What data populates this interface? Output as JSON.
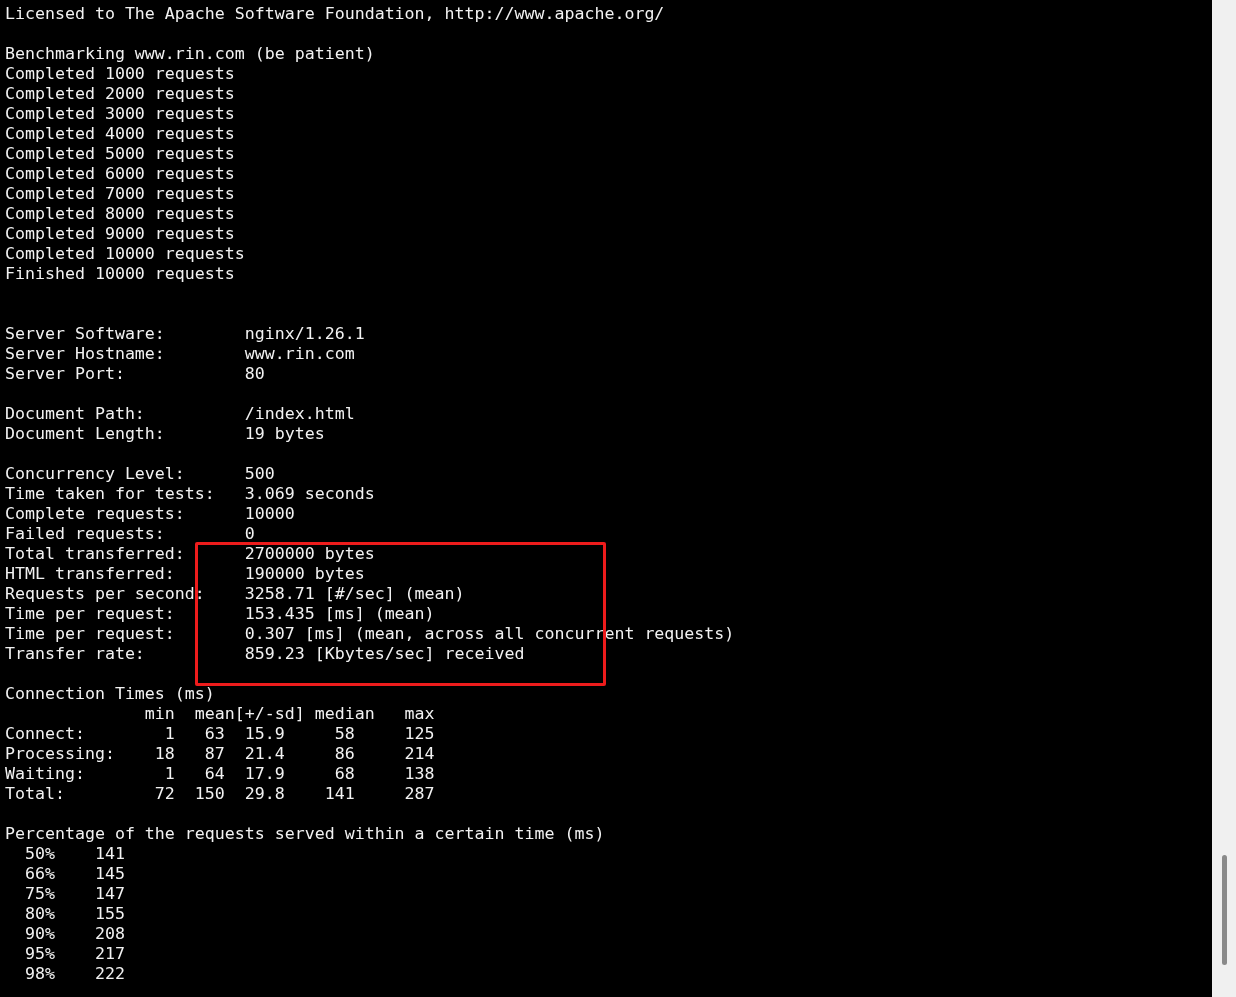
{
  "blocks": [
    {
      "kind": "header",
      "lines": [
        "Licensed to The Apache Software Foundation, http://www.apache.org/"
      ]
    },
    {
      "kind": "progress",
      "lines": [
        "Benchmarking www.rin.com (be patient)",
        "Completed 1000 requests",
        "Completed 2000 requests",
        "Completed 3000 requests",
        "Completed 4000 requests",
        "Completed 5000 requests",
        "Completed 6000 requests",
        "Completed 7000 requests",
        "Completed 8000 requests",
        "Completed 9000 requests",
        "Completed 10000 requests",
        "Finished 10000 requests"
      ]
    },
    {
      "kind": "details",
      "lines": [
        "Server Software:        nginx/1.26.1",
        "Server Hostname:        www.rin.com",
        "Server Port:            80"
      ]
    },
    {
      "kind": "details",
      "lines": [
        "Document Path:          /index.html",
        "Document Length:        19 bytes"
      ]
    },
    {
      "kind": "details",
      "lines": [
        "Concurrency Level:      500",
        "Time taken for tests:   3.069 seconds",
        "Complete requests:      10000",
        "Failed requests:        0",
        "Total transferred:      2700000 bytes",
        "HTML transferred:       190000 bytes",
        "Requests per second:    3258.71 [#/sec] (mean)",
        "Time per request:       153.435 [ms] (mean)",
        "Time per request:       0.307 [ms] (mean, across all concurrent requests)",
        "Transfer rate:          859.23 [Kbytes/sec] received"
      ]
    },
    {
      "kind": "details",
      "lines": [
        "Connection Times (ms)",
        "              min  mean[+/-sd] median   max",
        "Connect:        1   63  15.9     58     125",
        "Processing:    18   87  21.4     86     214",
        "Waiting:        1   64  17.9     68     138",
        "Total:         72  150  29.8    141     287"
      ]
    },
    {
      "kind": "details",
      "lines": [
        "Percentage of the requests served within a certain time (ms)",
        "  50%    141",
        "  66%    145",
        "  75%    147",
        "  80%    155",
        "  90%    208",
        "  95%    217",
        "  98%    222"
      ]
    }
  ],
  "annotation": {
    "kind": "rectangle"
  }
}
